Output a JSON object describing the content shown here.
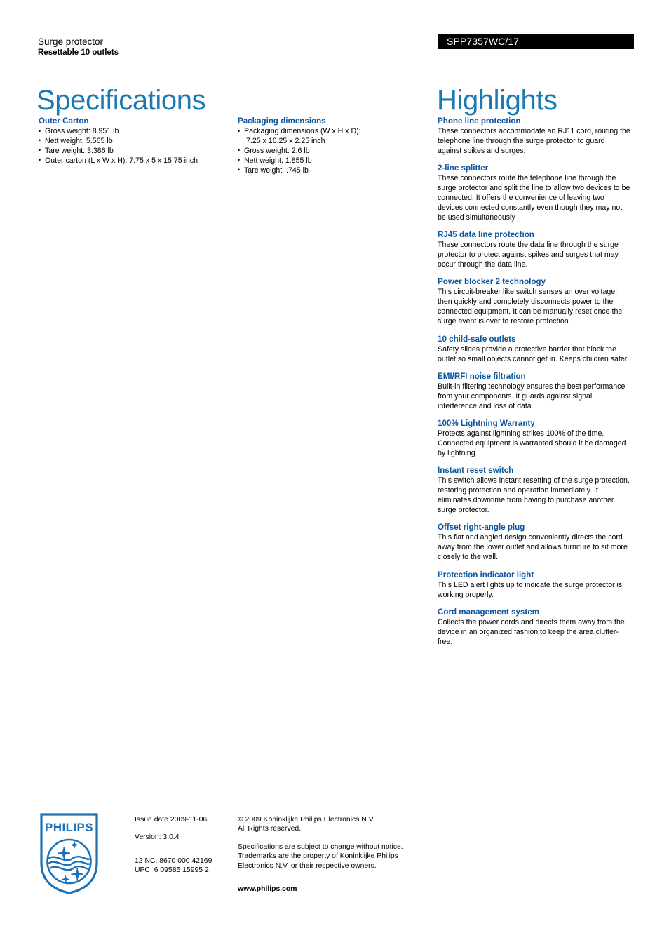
{
  "header": {
    "product_type": "Surge protector",
    "product_subtitle": "Resettable 10 outlets",
    "product_code": "SPP7357WC/17",
    "title_left": "Specifications",
    "title_right": "Highlights"
  },
  "specifications": [
    {
      "heading": "Outer Carton",
      "items": [
        {
          "text": "Gross weight: 8.951 lb"
        },
        {
          "text": "Nett weight: 5.565 lb"
        },
        {
          "text": "Tare weight: 3.386 lb"
        },
        {
          "text": "Outer carton (L x W x H): 7.75 x 5 x 15.75 inch"
        }
      ]
    },
    {
      "heading": "Packaging dimensions",
      "items": [
        {
          "text": "Packaging dimensions (W x H x D):",
          "cont": "7.25 x 16.25 x 2.25 inch"
        },
        {
          "text": "Gross weight: 2.6 lb"
        },
        {
          "text": "Nett weight: 1.855 lb"
        },
        {
          "text": "Tare weight: .745 lb"
        }
      ]
    }
  ],
  "highlights": [
    {
      "heading": "Phone line protection",
      "body": "These connectors accommodate an RJ11 cord, routing the telephone line through the surge protector to guard against spikes and surges."
    },
    {
      "heading": "2-line splitter",
      "body": "These connectors route the telephone line through the surge protector and split the line to allow two devices to be connected. It offers the convenience of leaving two devices connected constantly even though they may not be used simultaneously"
    },
    {
      "heading": "RJ45 data line protection",
      "body": "These connectors route the data line through the surge protector to protect against spikes and surges that may occur through the data line."
    },
    {
      "heading": "Power blocker 2 technology",
      "body": "This circuit-breaker like switch senses an over voltage, then quickly and completely disconnects power to the connected equipment. It can be manually reset once the surge event is over to restore protection."
    },
    {
      "heading": "10 child-safe outlets",
      "body": "Safety slides provide a protective barrier that block the outlet so small objects cannot get in. Keeps children safer."
    },
    {
      "heading": "EMI/RFI noise filtration",
      "body": "Built-in filtering technology ensures the best performance from your components. It guards against signal interference and loss of data."
    },
    {
      "heading": "100% Lightning Warranty",
      "body": "Protects against lightning strikes 100% of the time. Connected equipment is warranted should it be damaged by lightning."
    },
    {
      "heading": "Instant reset switch",
      "body": "This switch allows instant resetting of the surge protection, restoring protection and operation immediately. It eliminates downtime from having to purchase another surge protector."
    },
    {
      "heading": "Offset right-angle plug",
      "body": "This flat and angled design conveniently directs the cord away from the lower outlet and allows furniture to sit more closely to the wall."
    },
    {
      "heading": "Protection indicator light",
      "body": "This LED alert lights up to indicate the surge protector is working properly."
    },
    {
      "heading": "Cord management system",
      "body": "Collects the power cords and directs them away from the device in an organized fashion to keep the area clutter-free."
    }
  ],
  "footer": {
    "logo_wordmark": "PHILIPS",
    "issue_date": "Issue date 2009-11-06",
    "version": "Version: 3.0.4",
    "nc_code": "12 NC: 8670 000 42169",
    "upc_code": "UPC: 6 09585 15995 2",
    "copyright_line1": "© 2009 Koninklijke Philips Electronics N.V.",
    "copyright_line2": "All Rights reserved.",
    "disclaimer": "Specifications are subject to change without notice. Trademarks are the property of Koninklijke Philips Electronics N.V. or their respective owners.",
    "website": "www.philips.com"
  },
  "colors": {
    "title_blue": "#1a7ab5",
    "heading_blue": "#0c559f",
    "code_bar_bg": "#000000",
    "logo_blue": "#1a71b8"
  }
}
